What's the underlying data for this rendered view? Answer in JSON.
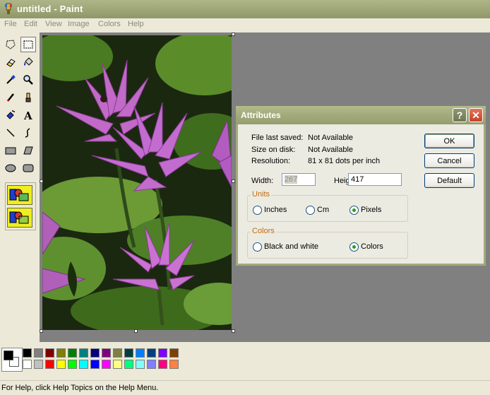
{
  "window": {
    "title": "untitled - Paint",
    "icon": "paint-app-icon"
  },
  "menu": [
    {
      "label": "File"
    },
    {
      "label": "Edit"
    },
    {
      "label": "View"
    },
    {
      "label": "Image"
    },
    {
      "label": "Colors"
    },
    {
      "label": "Help"
    }
  ],
  "tools": [
    "free-form-select-icon",
    "rect-select-icon",
    "eraser-icon",
    "fill-bucket-icon",
    "color-picker-icon",
    "magnifier-icon",
    "pencil-icon",
    "brush-icon",
    "airbrush-icon",
    "text-icon",
    "line-icon",
    "curve-icon",
    "rectangle-icon",
    "polygon-icon",
    "ellipse-icon",
    "rounded-rect-icon"
  ],
  "selected_tool": "rect-select-icon",
  "palette": {
    "foreground": "#000000",
    "background": "#ffffff",
    "row1": [
      "#000000",
      "#808080",
      "#800000",
      "#808000",
      "#008000",
      "#008080",
      "#000080",
      "#800080",
      "#808040",
      "#004040",
      "#0080ff",
      "#004080",
      "#8000ff",
      "#804000"
    ],
    "row2": [
      "#ffffff",
      "#c0c0c0",
      "#ff0000",
      "#ffff00",
      "#00ff00",
      "#00ffff",
      "#0000ff",
      "#ff00ff",
      "#ffff80",
      "#00ff80",
      "#80ffff",
      "#8080ff",
      "#ff0080",
      "#ff8040"
    ]
  },
  "status": {
    "text": "For Help, click Help Topics on the Help Menu."
  },
  "dialog": {
    "title": "Attributes",
    "help_label": "?",
    "close_label": "✕",
    "file_last_saved_label": "File last saved:",
    "file_last_saved_value": "Not Available",
    "size_on_disk_label": "Size on disk:",
    "size_on_disk_value": "Not Available",
    "resolution_label": "Resolution:",
    "resolution_value": "81 x 81 dots per inch",
    "width_label": "Width:",
    "width_value": "267",
    "height_label": "Height:",
    "height_value": "417",
    "units_title": "Units",
    "units": [
      {
        "label": "Inches",
        "checked": false
      },
      {
        "label": "Cm",
        "checked": false
      },
      {
        "label": "Pixels",
        "checked": true
      }
    ],
    "colors_title": "Colors",
    "colors": [
      {
        "label": "Black and white",
        "checked": false
      },
      {
        "label": "Colors",
        "checked": true
      }
    ],
    "ok_label": "OK",
    "cancel_label": "Cancel",
    "default_label": "Default"
  }
}
